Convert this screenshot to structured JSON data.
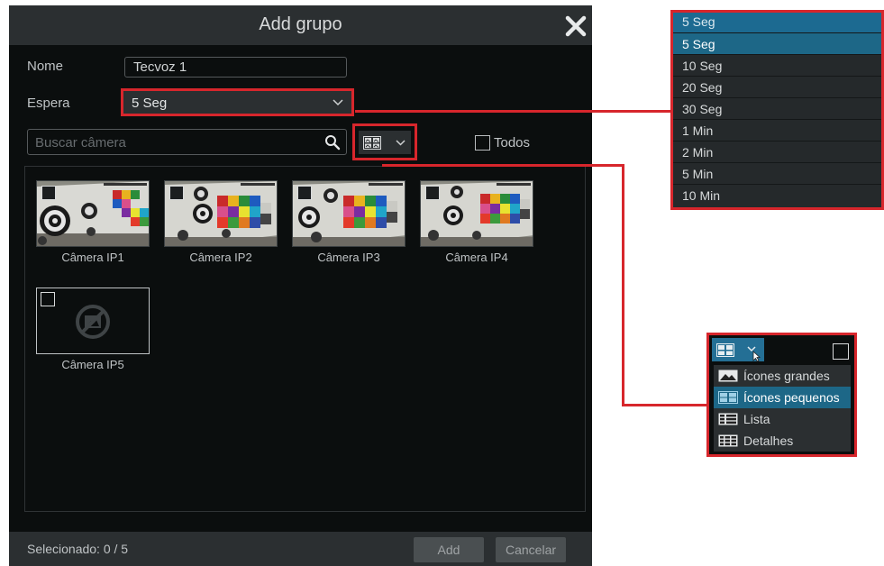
{
  "dialog": {
    "title": "Add grupo",
    "nome_label": "Nome",
    "nome_value": "Tecvoz 1",
    "espera_label": "Espera",
    "espera_value": "5 Seg",
    "search_placeholder": "Buscar câmera",
    "todos_label": "Todos",
    "cameras": [
      {
        "name": "Câmera IP1"
      },
      {
        "name": "Câmera IP2"
      },
      {
        "name": "Câmera IP3"
      },
      {
        "name": "Câmera IP4"
      },
      {
        "name": "Câmera IP5"
      }
    ],
    "selected_text": "Selecionado: 0 / 5",
    "add_label": "Add",
    "cancel_label": "Cancelar"
  },
  "espera_dropdown": {
    "current": "5 Seg",
    "options": [
      "5 Seg",
      "10 Seg",
      "20 Seg",
      "30 Seg",
      "1 Min",
      "2 Min",
      "5 Min",
      "10 Min"
    ],
    "selected": "5 Seg"
  },
  "view_dropdown": {
    "items": [
      {
        "label": "Ícones grandes",
        "icon": "large-icons-icon"
      },
      {
        "label": "Ícones pequenos",
        "icon": "small-icons-icon"
      },
      {
        "label": "Lista",
        "icon": "list-icon"
      },
      {
        "label": "Detalhes",
        "icon": "details-icon"
      }
    ],
    "selected": "Ícones pequenos"
  },
  "colors": {
    "highlight": "#d7262c",
    "selection": "#1d6787",
    "panel": "#2b2f31",
    "background": "#0b0e0e"
  }
}
